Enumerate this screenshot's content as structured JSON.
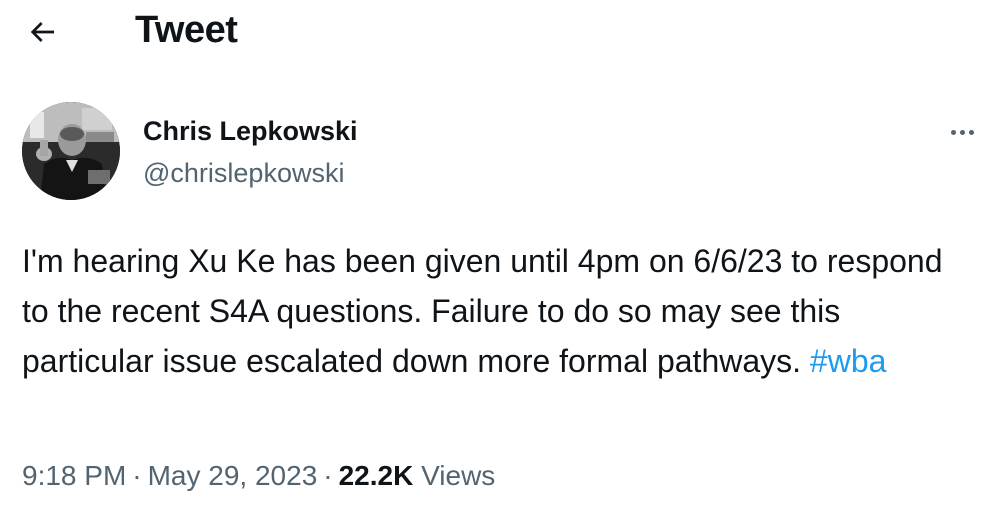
{
  "header": {
    "title": "Tweet"
  },
  "author": {
    "name": "Chris Lepkowski",
    "handle": "@chrislepkowski"
  },
  "tweet": {
    "text": "I'm hearing Xu Ke has been given until 4pm on 6/6/23 to respond to the recent S4A questions. Failure to do so may see this particular issue escalated down more formal pathways.",
    "hashtag": "#wba"
  },
  "meta": {
    "time": "9:18 PM",
    "separator": "·",
    "date": "May 29, 2023",
    "views_count": "22.2K",
    "views_label": "Views"
  },
  "icons": {
    "back": "arrow-left-icon",
    "more": "more-horizontal-icon"
  },
  "colors": {
    "text": "#0f1419",
    "secondary": "#536471",
    "link": "#1d9bf0"
  }
}
